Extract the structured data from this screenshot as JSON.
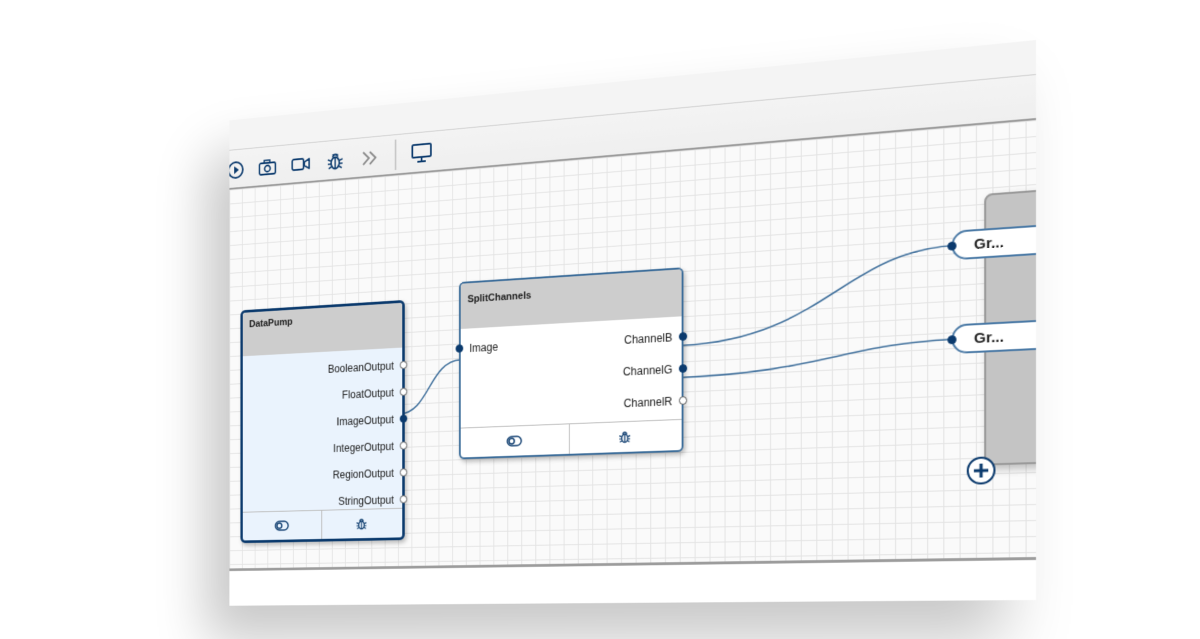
{
  "toolbar": {
    "buttons": [
      {
        "name": "play-button",
        "icon": "play-circle-icon"
      },
      {
        "name": "snapshot-button",
        "icon": "camera-icon"
      },
      {
        "name": "record-button",
        "icon": "video-camera-icon"
      },
      {
        "name": "debug-button",
        "icon": "bug-icon"
      },
      {
        "name": "step-forward-button",
        "icon": "double-chevron-right-icon"
      },
      {
        "name": "display-button",
        "icon": "monitor-icon"
      }
    ]
  },
  "nodes": {
    "datapump": {
      "title": "DataPump",
      "outputs": [
        "BooleanOutput",
        "FloatOutput",
        "ImageOutput",
        "IntegerOutput",
        "RegionOutput",
        "StringOutput"
      ]
    },
    "splitchannels": {
      "title": "SplitChannels",
      "inputs": [
        "Image"
      ],
      "outputs": [
        "ChannelB",
        "ChannelG",
        "ChannelR"
      ]
    },
    "group": {
      "ports": [
        "Gr...",
        "Gr..."
      ]
    }
  },
  "colors": {
    "accent": "#0b3a6d",
    "node_border": "#3c6d9a",
    "header_gray": "#cdcdcd",
    "selected_fill": "#eaf3fd"
  }
}
